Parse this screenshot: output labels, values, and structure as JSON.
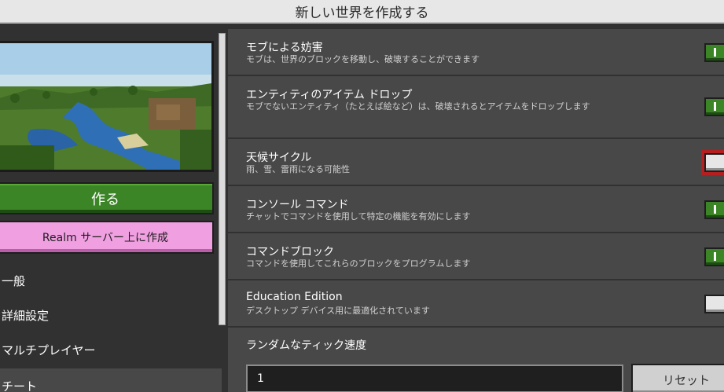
{
  "header": {
    "title": "新しい世界を作成する"
  },
  "left": {
    "create_label": "作る",
    "realm_label": "Realm サーバー上に作成",
    "nav": [
      {
        "label": "一般"
      },
      {
        "label": "詳細設定"
      },
      {
        "label": "マルチプレイヤー"
      },
      {
        "label": "チート"
      }
    ],
    "selected_nav": "チート"
  },
  "settings": [
    {
      "title": "モブによる妨害",
      "desc": "モブは、世界のブロックを移動し、破壊することができます",
      "state": "on",
      "icon": "toggle-on"
    },
    {
      "title": "エンティティのアイテム ドロップ",
      "desc": "モブでないエンティティ（たとえば絵など）は、破壊されるとアイテムをドロップします",
      "state": "on",
      "icon": "toggle-on"
    },
    {
      "title": "天候サイクル",
      "desc": "雨、雪、雷雨になる可能性",
      "state": "off",
      "icon": "toggle-off",
      "focused": true
    },
    {
      "title": "コンソール コマンド",
      "desc": "チャットでコマンドを使用して特定の機能を有効にします",
      "state": "on",
      "icon": "toggle-on"
    },
    {
      "title": "コマンドブロック",
      "desc": "コマンドを使用してこれらのブロックをプログラムします",
      "state": "on",
      "icon": "toggle-on"
    },
    {
      "title": "Education Edition",
      "desc": "デスクトップ デバイス用に最適化されています",
      "state": "off",
      "icon": "toggle-off"
    }
  ],
  "tick": {
    "label": "ランダムなティック速度",
    "value": "1",
    "reset_label": "リセット"
  },
  "colors": {
    "toggle_on": "#3c8527",
    "create_button": "#3c8527",
    "realm_button": "#f09fe1",
    "focus_outline": "#b51f1f"
  }
}
